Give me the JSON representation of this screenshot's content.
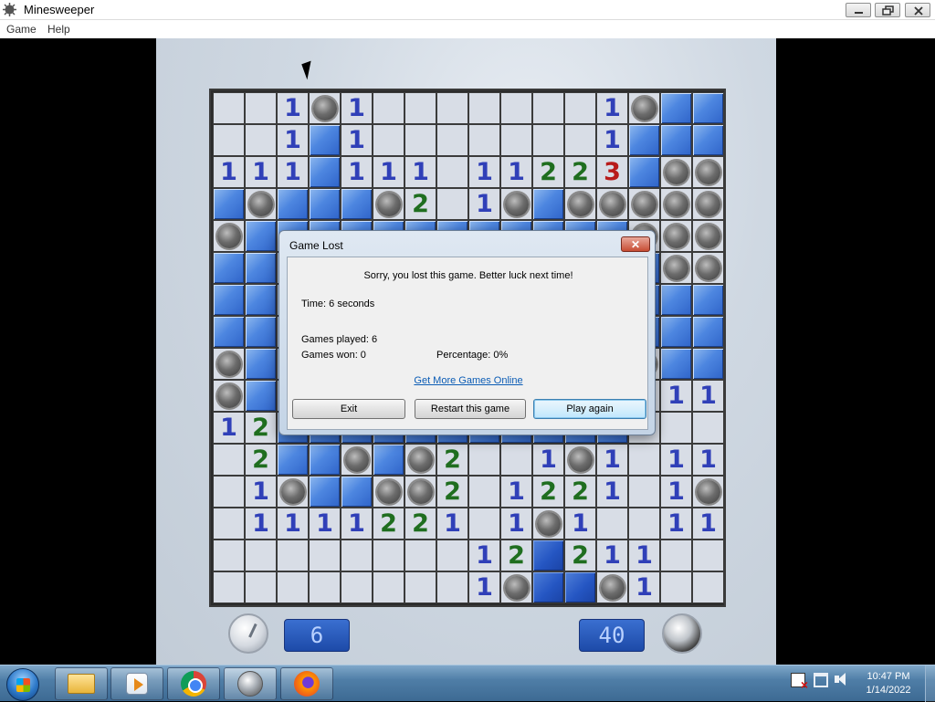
{
  "window": {
    "title": "Minesweeper"
  },
  "menu": {
    "items": [
      "Game",
      "Help"
    ]
  },
  "board": {
    "rows": [
      [
        ".",
        ".",
        "1",
        "m",
        "1",
        ".",
        ".",
        ".",
        ".",
        ".",
        ".",
        ".",
        "1",
        "m",
        "c",
        "c"
      ],
      [
        ".",
        ".",
        "1",
        "c",
        "1",
        ".",
        ".",
        ".",
        ".",
        ".",
        ".",
        ".",
        "1",
        "c",
        "c",
        "c"
      ],
      [
        "1",
        "1",
        "1",
        "c",
        "1",
        "1",
        "1",
        ".",
        "1",
        "1",
        "2",
        "2",
        "3",
        "c",
        "m",
        "m"
      ],
      [
        "c",
        "m",
        "c",
        "c",
        "c",
        "m",
        "2",
        ".",
        "1",
        "m",
        "c",
        "m",
        "m",
        "m",
        "m",
        "m"
      ],
      [
        "m",
        "c",
        "c",
        "c",
        "c",
        "c",
        "c",
        "c",
        "c",
        "c",
        "c",
        "c",
        "c",
        "m",
        "m",
        "m"
      ],
      [
        "c",
        "c",
        "c",
        "c",
        "c",
        "c",
        "c",
        "c",
        "c",
        "c",
        "c",
        "c",
        "c",
        "c",
        "m",
        "m"
      ],
      [
        "c",
        "c",
        "c",
        "c",
        "c",
        "c",
        "c",
        "c",
        "c",
        "c",
        "c",
        "c",
        "c",
        "c",
        "c",
        "c"
      ],
      [
        "c",
        "c",
        "c",
        "c",
        "c",
        "c",
        "c",
        "c",
        "c",
        "c",
        "c",
        "c",
        "c",
        "c",
        "c",
        "c"
      ],
      [
        "m",
        "c",
        "c",
        "c",
        "c",
        "c",
        "c",
        "c",
        "c",
        "c",
        "c",
        "c",
        "c",
        "m",
        "c",
        "c"
      ],
      [
        "m",
        "c",
        "c",
        "c",
        "c",
        "c",
        "c",
        "c",
        "c",
        "c",
        "c",
        "c",
        "c",
        "1",
        "1",
        "1"
      ],
      [
        "1",
        "2",
        "c",
        "c",
        "c",
        "c",
        "c",
        "c",
        "c",
        "c",
        "c",
        "c",
        "c",
        ".",
        ".",
        "."
      ],
      [
        ".",
        "2",
        "c",
        "c",
        "m",
        "c",
        "m",
        "2",
        ".",
        ".",
        "1",
        "m",
        "1",
        ".",
        "1",
        "1"
      ],
      [
        ".",
        "1",
        "m",
        "c",
        "c",
        "m",
        "m",
        "2",
        ".",
        "1",
        "2",
        "2",
        "1",
        ".",
        "1",
        "m"
      ],
      [
        ".",
        "1",
        "1",
        "1",
        "1",
        "2",
        "2",
        "1",
        ".",
        "1",
        "m",
        "1",
        ".",
        ".",
        "1",
        "1"
      ],
      [
        ".",
        ".",
        ".",
        ".",
        ".",
        ".",
        ".",
        ".",
        "1",
        "2",
        "d",
        "2",
        "1",
        "1",
        ".",
        "."
      ],
      [
        ".",
        ".",
        ".",
        ".",
        ".",
        ".",
        ".",
        ".",
        "1",
        "m",
        "d",
        "d",
        "m",
        "1",
        ".",
        "."
      ]
    ]
  },
  "counters": {
    "time": "6",
    "mines": "40"
  },
  "dialog": {
    "title": "Game Lost",
    "message": "Sorry, you lost this game. Better luck next time!",
    "time": "Time: 6 seconds",
    "games_played": "Games played: 6",
    "games_won": "Games won: 0",
    "percentage": "Percentage: 0%",
    "link": "Get More Games Online",
    "buttons": {
      "exit": "Exit",
      "restart": "Restart this game",
      "play_again": "Play again"
    }
  },
  "taskbar": {
    "time": "10:47 PM",
    "date": "1/14/2022"
  },
  "colors": {
    "covered_tile": "#4d86e0",
    "number_1": "#3040b8",
    "number_2": "#1f6e1f",
    "number_3": "#b81a1a"
  }
}
